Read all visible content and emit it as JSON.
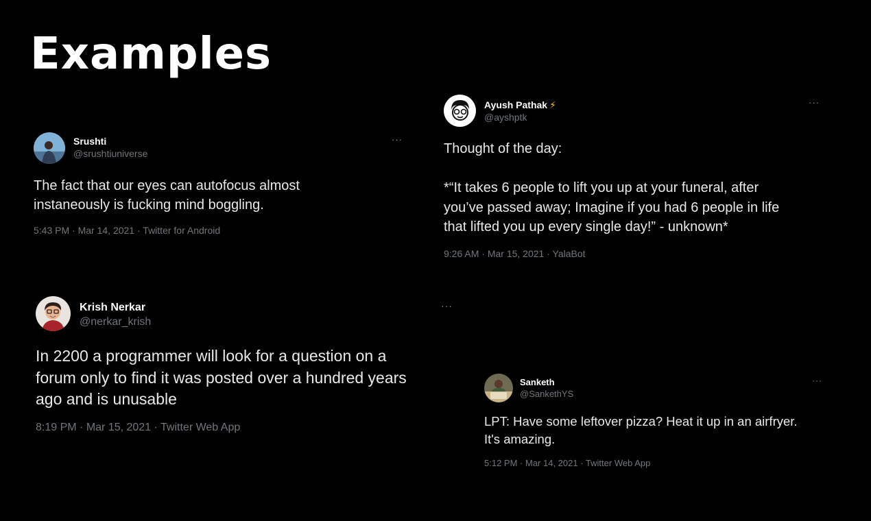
{
  "page": {
    "title": "Examples"
  },
  "tweets": [
    {
      "display_name": "Srushti",
      "handle": "@srushtiuniverse",
      "text": "The fact that our eyes can autofocus almost\ninstaneously is fucking mind boggling.",
      "time": "5:43 PM",
      "date": "Mar 14, 2021",
      "source": "Twitter for Android",
      "more_icon": "more-horizontal-icon",
      "avatar_icon": "user-photo-avatar"
    },
    {
      "display_name": "Ayush Pathak",
      "name_emoji": "⚡",
      "handle": "@ayshptk",
      "text": "Thought of the day:\n\n*“It takes 6 people to lift you up at your funeral, after\nyou’ve passed away; Imagine if you had 6 people in life\nthat lifted you up every single day!” - unknown*",
      "time": "9:26 AM",
      "date": "Mar 15, 2021",
      "source": "YalaBot",
      "more_icon": "more-horizontal-icon",
      "avatar_icon": "cartoon-face-avatar"
    },
    {
      "display_name": "Krish Nerkar",
      "handle": "@nerkar_krish",
      "text": "In 2200 a programmer will look for a question on a\nforum only to find it was posted over a hundred years\nago and is unusable",
      "time": "8:19 PM",
      "date": "Mar 15, 2021",
      "source": "Twitter Web App",
      "more_icon": "more-horizontal-icon",
      "avatar_icon": "memoji-avatar"
    },
    {
      "display_name": "Sanketh",
      "handle": "@SankethYS",
      "text": "LPT: Have some leftover pizza? Heat it up in an airfryer.\nIt's amazing.",
      "time": "5:12 PM",
      "date": "Mar 14, 2021",
      "source": "Twitter Web App",
      "more_icon": "more-horizontal-icon",
      "avatar_icon": "user-photo-avatar"
    }
  ],
  "labels": {
    "separator": " · ",
    "more": "···"
  },
  "colors": {
    "background": "#000000",
    "text": "#e7e9ea",
    "secondary_text": "#71767b",
    "bolt": "#f2c200"
  }
}
